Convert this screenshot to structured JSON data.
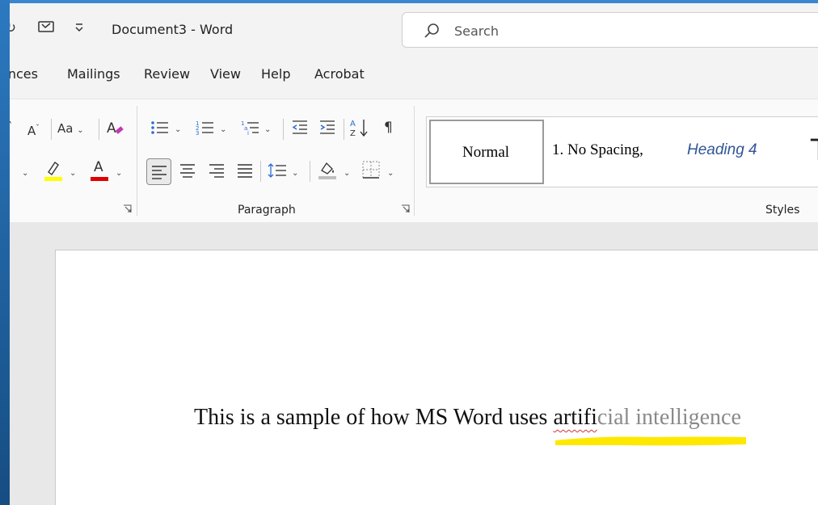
{
  "window": {
    "title": "Document3  -  Word"
  },
  "search": {
    "placeholder": "Search"
  },
  "tabs": [
    "ences",
    "Mailings",
    "Review",
    "View",
    "Help",
    "Acrobat"
  ],
  "ribbon": {
    "font_group": {
      "grow_font_label": "A",
      "change_case_label": "Aa",
      "font_color_label": "A",
      "highlight_color": "#ffff00",
      "font_color": "#e00000"
    },
    "paragraph_group": {
      "label": "Paragraph"
    },
    "styles_group": {
      "label": "Styles",
      "items": [
        "Normal",
        "1.  No Spacing,",
        "Heading 4"
      ],
      "next_preview": "T",
      "heading_color": "#2f5597"
    }
  },
  "document": {
    "text_typed": "This is a sample of how MS Word uses artifi",
    "text_suggested": "cial intelligence",
    "misspelled_fragment": "artifi"
  },
  "colors": {
    "accent_blue": "#1f5e96",
    "suggestion_underline": "#ffe800"
  }
}
